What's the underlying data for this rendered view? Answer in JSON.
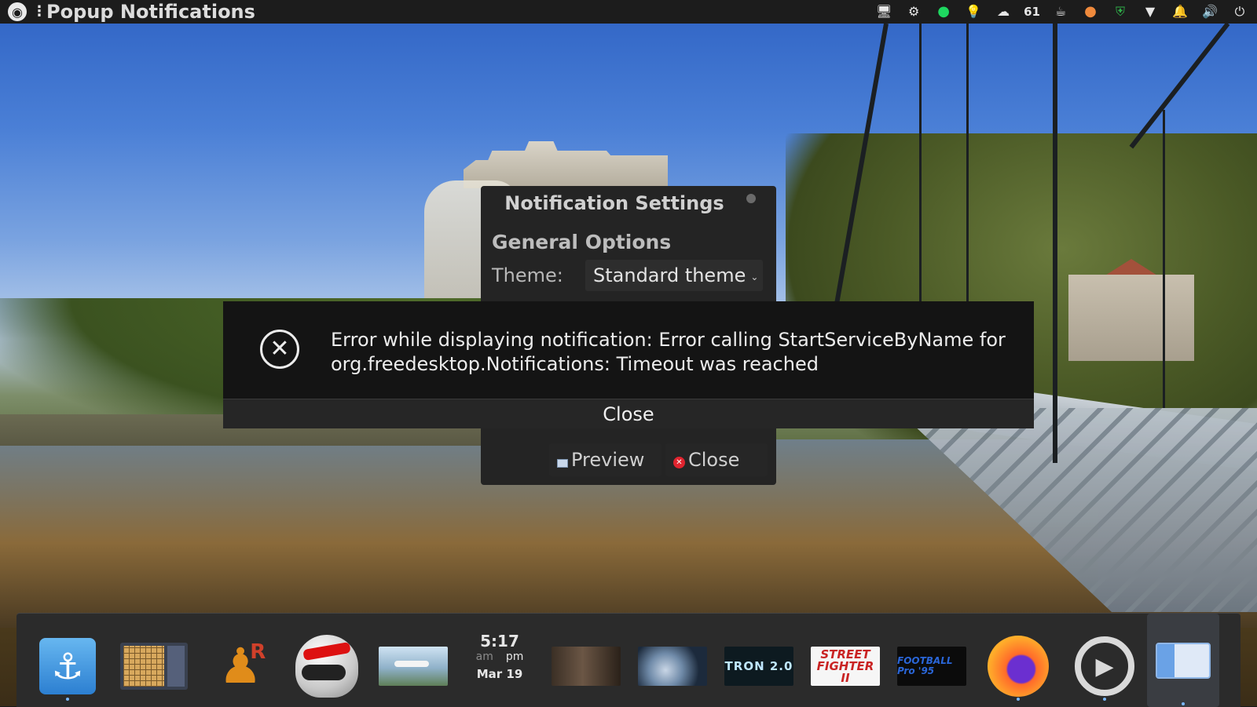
{
  "top_panel": {
    "app_icon": "ubuntu-logo-icon",
    "title": "Popup Notifications",
    "tray": [
      {
        "icon": "display-icon",
        "glyph": "🖥"
      },
      {
        "icon": "steam-icon",
        "glyph": "⚙"
      },
      {
        "icon": "spotify-icon",
        "glyph": "●"
      },
      {
        "icon": "lightbulb-icon",
        "glyph": "💡"
      },
      {
        "icon": "weather-icon",
        "glyph": "☁"
      },
      {
        "icon": "temperature-text",
        "text": "61"
      },
      {
        "icon": "coffee-icon",
        "glyph": "☕"
      },
      {
        "icon": "mango-icon",
        "glyph": "●"
      },
      {
        "icon": "shield-icon",
        "glyph": "⛨"
      },
      {
        "icon": "wifi-icon",
        "glyph": "▼"
      },
      {
        "icon": "bell-icon",
        "glyph": "🔔"
      },
      {
        "icon": "volume-icon",
        "glyph": "🔊"
      },
      {
        "icon": "power-icon",
        "glyph": "⏻"
      }
    ]
  },
  "settings_window": {
    "title": "Notification Settings",
    "section": "General Options",
    "theme_label": "Theme:",
    "theme_value": "Standard theme",
    "preview_button": "Preview",
    "close_button": "Close"
  },
  "error_dialog": {
    "icon": "close-circle-icon",
    "message_line1": "Error while displaying notification: Error calling StartServiceByName for",
    "message_line2": "org.freedesktop.Notifications: Timeout was reached",
    "close_button": "Close"
  },
  "dock": {
    "clock": {
      "time": "5:17",
      "am": "am",
      "pm": "pm",
      "date": "Mar 19"
    },
    "items": [
      {
        "name": "anchor-app"
      },
      {
        "name": "go-game"
      },
      {
        "name": "chess-app"
      },
      {
        "name": "racing-game"
      },
      {
        "name": "flight-sim"
      },
      {
        "name": "clock"
      },
      {
        "name": "noir-game"
      },
      {
        "name": "space-game"
      },
      {
        "name": "tron-game",
        "label": "TRON 2.0"
      },
      {
        "name": "street-fighter-game",
        "label": "STREET FIGHTER II"
      },
      {
        "name": "football-game",
        "label": "FOOTBALL Pro '95"
      },
      {
        "name": "firefox"
      },
      {
        "name": "settings"
      },
      {
        "name": "popup-notifications"
      }
    ]
  },
  "colors": {
    "panel_bg": "#1c1c1c",
    "dialog_bg": "#141414",
    "window_bg": "#242424",
    "accent_blue": "#7ab8ff",
    "error_close_bg": "#262626"
  }
}
